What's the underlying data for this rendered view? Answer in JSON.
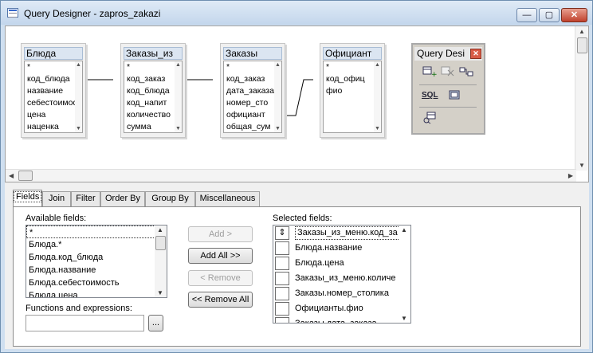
{
  "window": {
    "title": "Query Designer - zapros_zakazi",
    "controls": {
      "minimize": "—",
      "maximize": "▢",
      "close": "✕"
    }
  },
  "diagram": {
    "tables": [
      {
        "name": "Блюда",
        "fields": [
          "*",
          "код_блюда",
          "название",
          "себестоимость",
          "цена",
          "наценка"
        ]
      },
      {
        "name": "Заказы_из",
        "fields": [
          "*",
          "код_заказ",
          "код_блюда",
          "код_напит",
          "количество",
          "сумма"
        ]
      },
      {
        "name": "Заказы",
        "fields": [
          "*",
          "код_заказ",
          "дата_заказа",
          "номер_сто",
          "официант",
          "общая_сум"
        ]
      },
      {
        "name": "Официант",
        "fields": [
          "*",
          "код_офиц",
          "фио"
        ]
      }
    ],
    "query_toolbar": {
      "title": "Query Desi",
      "icons": [
        "add-table-icon",
        "remove-table-icon",
        "join-icon",
        "sql-icon",
        "grid-view-icon",
        "run-query-icon"
      ],
      "sql_label": "SQL"
    }
  },
  "tabs": [
    "Fields",
    "Join",
    "Filter",
    "Order By",
    "Group By",
    "Miscellaneous"
  ],
  "active_tab": "Fields",
  "fields_panel": {
    "available_label": "Available fields:",
    "available_fields": [
      "*",
      "Блюда.*",
      "Блюда.код_блюда",
      "Блюда.название",
      "Блюда.себестоимость",
      "Блюда.цена"
    ],
    "functions_label": "Functions and expressions:",
    "functions_value": "",
    "ellipsis_button": "...",
    "buttons": {
      "add": "Add >",
      "add_all": "Add All >>",
      "remove": "< Remove",
      "remove_all": "<< Remove All"
    },
    "selected_label": "Selected fields:",
    "selected_fields": [
      "Заказы_из_меню.код_за",
      "Блюда.название",
      "Блюда.цена",
      "Заказы_из_меню.количе",
      "Заказы.номер_столика",
      "Официанты.фио",
      "Заказы.дата_заказа"
    ]
  }
}
